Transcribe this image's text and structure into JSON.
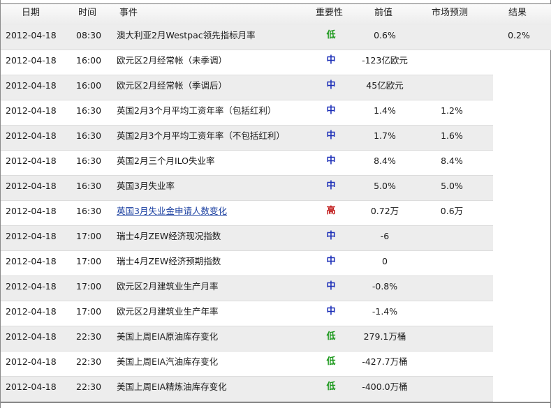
{
  "headers": {
    "date": "日期",
    "time": "时间",
    "event": "事件",
    "importance": "重要性",
    "previous": "前值",
    "forecast": "市场预测",
    "result": "结果"
  },
  "rows": [
    {
      "date": "2012-04-18",
      "time": "08:30",
      "event": "澳大利亚2月Westpac领先指标月率",
      "importance": "低",
      "previous": "0.6%",
      "forecast": "",
      "result": "0.2%"
    },
    {
      "date": "2012-04-18",
      "time": "16:00",
      "event": "欧元区2月经常帐（未季调）",
      "importance": "中",
      "previous": "-123亿欧元",
      "forecast": "",
      "result": ""
    },
    {
      "date": "2012-04-18",
      "time": "16:00",
      "event": "欧元区2月经常帐（季调后）",
      "importance": "中",
      "previous": "45亿欧元",
      "forecast": "",
      "result": ""
    },
    {
      "date": "2012-04-18",
      "time": "16:30",
      "event": "英国2月3个月平均工资年率（包括红利）",
      "importance": "中",
      "previous": "1.4%",
      "forecast": "1.2%",
      "result": ""
    },
    {
      "date": "2012-04-18",
      "time": "16:30",
      "event": "英国2月3个月平均工资年率（不包括红利）",
      "importance": "中",
      "previous": "1.7%",
      "forecast": "1.6%",
      "result": ""
    },
    {
      "date": "2012-04-18",
      "time": "16:30",
      "event": "英国2月三个月ILO失业率",
      "importance": "中",
      "previous": "8.4%",
      "forecast": "8.4%",
      "result": ""
    },
    {
      "date": "2012-04-18",
      "time": "16:30",
      "event": "英国3月失业率",
      "importance": "中",
      "previous": "5.0%",
      "forecast": "5.0%",
      "result": ""
    },
    {
      "date": "2012-04-18",
      "time": "16:30",
      "event": "英国3月失业金申请人数变化",
      "importance": "高",
      "previous": "0.72万",
      "forecast": "0.6万",
      "result": "",
      "link": true
    },
    {
      "date": "2012-04-18",
      "time": "17:00",
      "event": "瑞士4月ZEW经济现况指数",
      "importance": "中",
      "previous": "-6",
      "forecast": "",
      "result": ""
    },
    {
      "date": "2012-04-18",
      "time": "17:00",
      "event": "瑞士4月ZEW经济预期指数",
      "importance": "中",
      "previous": "0",
      "forecast": "",
      "result": ""
    },
    {
      "date": "2012-04-18",
      "time": "17:00",
      "event": "欧元区2月建筑业生产月率",
      "importance": "中",
      "previous": "-0.8%",
      "forecast": "",
      "result": ""
    },
    {
      "date": "2012-04-18",
      "time": "17:00",
      "event": "欧元区2月建筑业生产年率",
      "importance": "中",
      "previous": "-1.4%",
      "forecast": "",
      "result": ""
    },
    {
      "date": "2012-04-18",
      "time": "22:30",
      "event": "美国上周EIA原油库存变化",
      "importance": "低",
      "previous": "279.1万桶",
      "forecast": "",
      "result": ""
    },
    {
      "date": "2012-04-18",
      "time": "22:30",
      "event": "美国上周EIA汽油库存变化",
      "importance": "低",
      "previous": "-427.7万桶",
      "forecast": "",
      "result": ""
    },
    {
      "date": "2012-04-18",
      "time": "22:30",
      "event": "美国上周EIA精炼油库存变化",
      "importance": "低",
      "previous": "-400.0万桶",
      "forecast": "",
      "result": ""
    }
  ],
  "importance_colors": {
    "低": "#1f9a1f",
    "中": "#1c2fb8",
    "高": "#c01818"
  }
}
